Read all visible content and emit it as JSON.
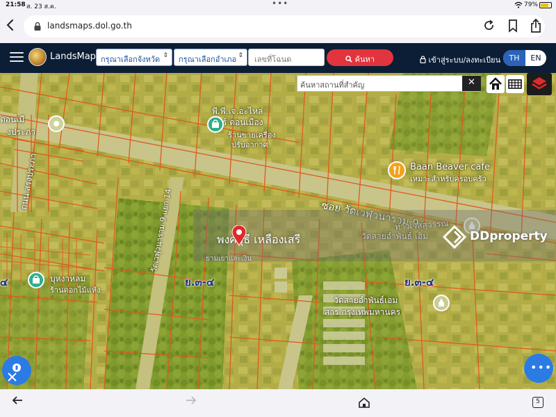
{
  "status_bar": {
    "time": "21:58",
    "date": "ส. 23 ส.ค.",
    "dots": "•••",
    "battery_pct": "79%",
    "battery_level": 0.79
  },
  "browser": {
    "url": "landsmaps.dol.go.th",
    "tabs_count": "5"
  },
  "app_nav": {
    "brand": "LandsMaps",
    "province_select": "กรุณาเลือกจังหวัด",
    "district_select": "กรุณาเลือกอำเภอ",
    "deed_placeholder": "เลขที่โฉนด",
    "search_label": "ค้นหา",
    "login_label": "เข้าสู่ระบบ/ลงทะเบียน",
    "lang_th": "TH",
    "lang_en": "EN"
  },
  "map": {
    "place_search_placeholder": "ค้นหาสถานที่สำคัญ",
    "clear_label": "✕",
    "owner_name": "พงศ์สุธี เหลืองเสรี",
    "owner_sub": "ยามเยาและเงิน",
    "watermark": "DDproperty",
    "labels": {
      "shop_name": "พี.พี.เจ.อะไหล่",
      "shop_name2": "แอร์ ดอนเมือง",
      "shop_desc": "ร้านขายเครื่อง",
      "shop_desc2": "ปรับอากาศ",
      "cafe_name": "Baan Beaver cafe",
      "cafe_desc": "เหมาะสำหรับครอบครัว",
      "soi_name": "ซอย วัดเวฬุวนาราม 9",
      "temple_top": "ท่าวเวสสุวรรณ",
      "temple_top2": "วัดสายอำพันธ์ เอิ่ม",
      "temple_name": "วัดสายอำพันธ์เอม",
      "temple_area": "สาร กรุงเทพมหานคร",
      "road_vertical": "ถนน สรงประภา",
      "road_diag": "วัดเวฬุวนาราม 9 แยก 14",
      "shop_left": "บุหงาหลม",
      "shop_left_desc": "ร้านดอกไม้แห้ง",
      "don_left": "ดอนเมื",
      "don_left2": "งประภา",
      "zone1": "ย.๓-๔",
      "zone2": "ย.๓-๔",
      "zone_edge": "๔"
    }
  },
  "colors": {
    "nav_bg": "#0c1e36",
    "search_red": "#e2343d",
    "accent_blue": "#2a63b9",
    "parcel_line": "#e05a1a",
    "fab_blue": "#2b7be4"
  },
  "icons": [
    "back-icon",
    "lock-icon",
    "reload-icon",
    "bookmark-icon",
    "share-icon",
    "hamburger-icon",
    "search-icon",
    "lock-user-icon",
    "home-icon",
    "grid-icon",
    "layers-icon",
    "map-pin-icon",
    "cafe-icon",
    "shop-icon",
    "temple-icon",
    "help-icon",
    "edit-icon",
    "more-icon",
    "forward-icon",
    "tabs-icon"
  ]
}
